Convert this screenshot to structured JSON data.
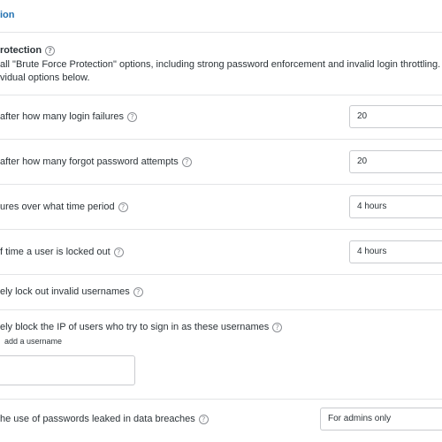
{
  "header": {
    "title": "ion"
  },
  "protection": {
    "title": "rotection",
    "description_line1": "all \"Brute Force Protection\" options, including strong password enforcement and invalid login throttling.",
    "description_line2": "vidual options below."
  },
  "settings": {
    "login_failures": {
      "label": "after how many login failures",
      "value": "20"
    },
    "forgot_password": {
      "label": "after how many forgot password attempts",
      "value": "20"
    },
    "time_period": {
      "label": "ures over what time period",
      "value": "4 hours"
    },
    "lockout_time": {
      "label": "f time a user is locked out",
      "value": "4 hours"
    },
    "lock_invalid_usernames": {
      "label": "ely lock out invalid usernames"
    },
    "block_ip": {
      "label": "ely block the IP of users who try to sign in as these usernames",
      "hint": "add a username"
    },
    "leaked_passwords": {
      "label": "he use of passwords leaked in data breaches",
      "value": "For admins only"
    }
  },
  "icons": {
    "help": "question-circle-icon"
  }
}
